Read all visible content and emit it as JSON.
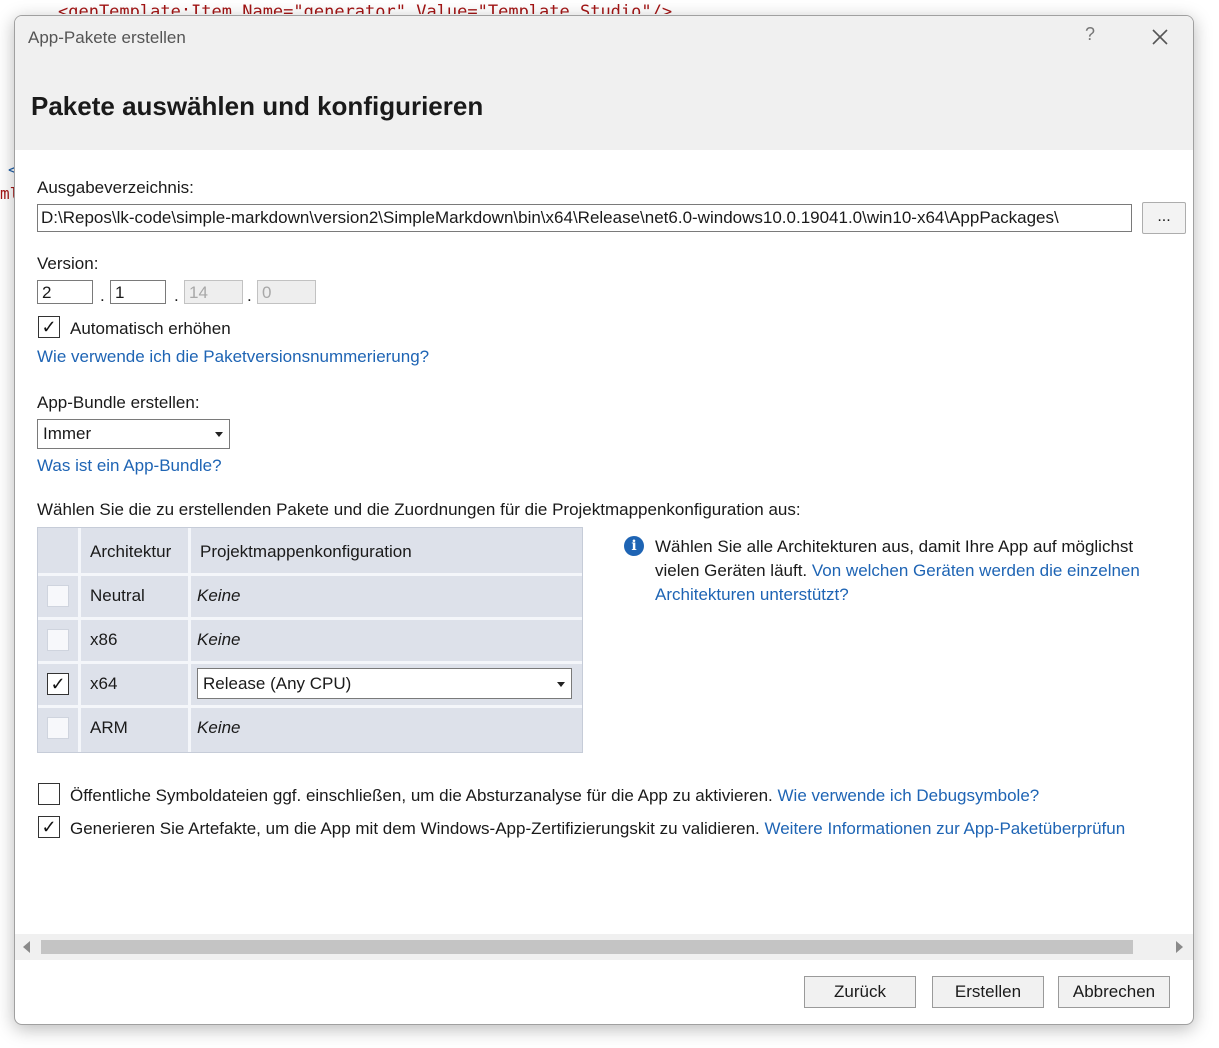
{
  "background_code": {
    "line1": "<genTemplate:Item Name=\"generator\" Value=\"Template Studio\"/>",
    "frag1": "<",
    "frag2": "ml"
  },
  "window": {
    "title": "App-Pakete erstellen",
    "help_label": "?",
    "close_icon": "close-icon"
  },
  "page": {
    "heading": "Pakete auswählen und konfigurieren"
  },
  "output": {
    "label": "Ausgabeverzeichnis:",
    "value": "D:\\Repos\\lk-code\\simple-markdown\\version2\\SimpleMarkdown\\bin\\x64\\Release\\net6.0-windows10.0.19041.0\\win10-x64\\AppPackages\\",
    "browse_label": "..."
  },
  "version": {
    "label": "Version:",
    "major": "2",
    "minor": "1",
    "build": "14",
    "revision": "0",
    "separator": ".",
    "auto_increment_label": "Automatisch erhöhen",
    "auto_increment_checked": true,
    "help_link": "Wie verwende ich die Paketversionsnummerierung?"
  },
  "bundle": {
    "label": "App-Bundle erstellen:",
    "selected": "Immer",
    "help_link": "Was ist ein App-Bundle?"
  },
  "packages": {
    "instruction": "Wählen Sie die zu erstellenden Pakete und die Zuordnungen für die Projektmappenkonfiguration aus:",
    "columns": [
      "Architektur",
      "Projektmappenkonfiguration"
    ],
    "rows": [
      {
        "arch": "Neutral",
        "config": "Keine",
        "checked": false
      },
      {
        "arch": "x86",
        "config": "Keine",
        "checked": false
      },
      {
        "arch": "x64",
        "config": "Release (Any CPU)",
        "checked": true
      },
      {
        "arch": "ARM",
        "config": "Keine",
        "checked": false
      }
    ],
    "check_mark": "✓"
  },
  "info": {
    "text": "Wählen Sie alle Architekturen aus, damit Ihre App auf möglichst vielen Geräten läuft.",
    "link": "Von welchen Geräten werden die einzelnen Architekturen unterstützt?",
    "icon": "info-icon",
    "icon_glyph": "i"
  },
  "options": {
    "symbols_label": "Öffentliche Symboldateien ggf. einschließen, um die Absturzanalyse für die App zu aktivieren.",
    "symbols_link": "Wie verwende ich Debugsymbole?",
    "symbols_checked": false,
    "wack_label": "Generieren Sie Artefakte, um die App mit dem Windows-App-Zertifizierungskit zu validieren.",
    "wack_link": "Weitere Informationen zur App-Paketüberprüfun",
    "wack_checked": true
  },
  "buttons": {
    "back": "Zurück",
    "create": "Erstellen",
    "cancel": "Abbrechen"
  },
  "colors": {
    "link": "#1e64b4",
    "grid_bg": "#dde1ea",
    "titlebar_bg": "#f0f0f0"
  }
}
